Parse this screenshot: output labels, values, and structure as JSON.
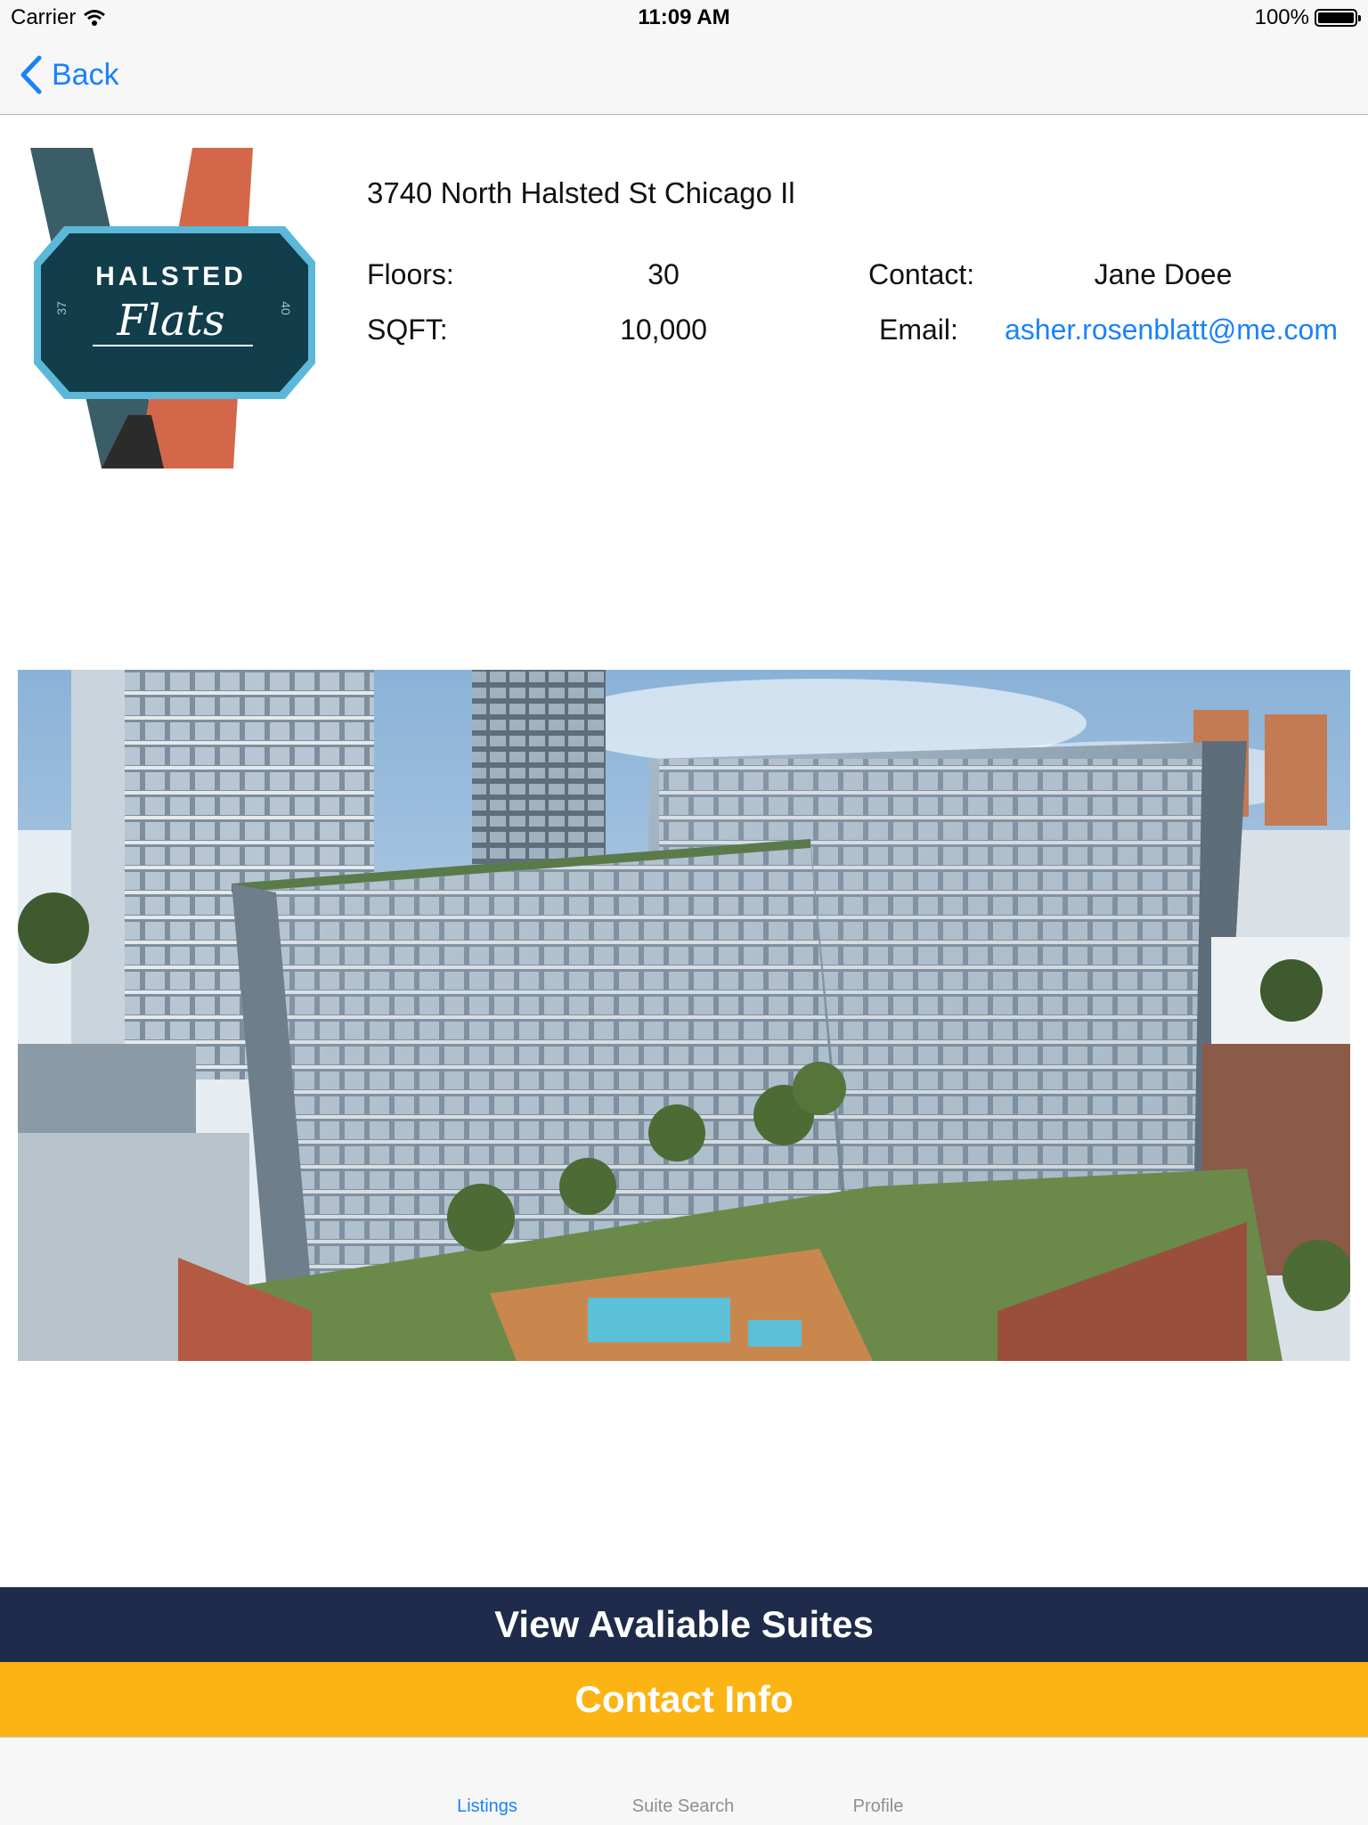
{
  "status_bar": {
    "carrier": "Carrier",
    "time": "11:09 AM",
    "battery": "100%"
  },
  "nav": {
    "back_label": "Back"
  },
  "logo": {
    "line1": "HALSTED",
    "line2": "Flats",
    "num_left": "37",
    "num_right": "40"
  },
  "listing": {
    "address": "3740 North Halsted St Chicago Il",
    "floors_label": "Floors:",
    "floors_value": "30",
    "sqft_label": "SQFT:",
    "sqft_value": "10,000",
    "contact_label": "Contact:",
    "contact_value": "Jane Doee",
    "email_label": "Email:",
    "email_value": "asher.rosenblatt@me.com"
  },
  "actions": {
    "suites_label": "View Avaliable Suites",
    "contact_label": "Contact Info"
  },
  "tabs": [
    {
      "label": "Listings",
      "active": true
    },
    {
      "label": "Suite Search",
      "active": false
    },
    {
      "label": "Profile",
      "active": false
    }
  ],
  "colors": {
    "accent": "#1a82fb",
    "navy": "#1e2b4a",
    "gold": "#fbb413"
  }
}
